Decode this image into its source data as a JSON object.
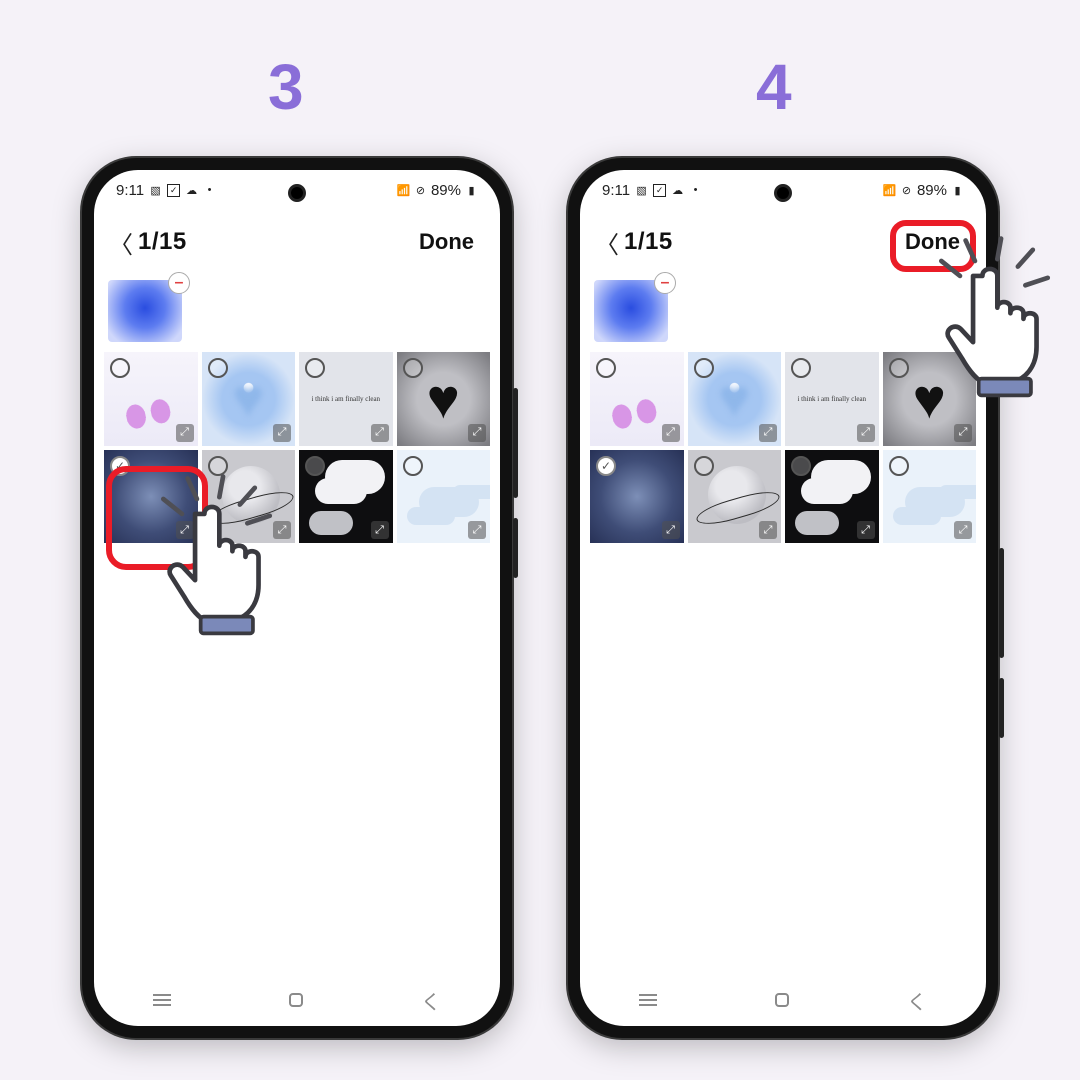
{
  "steps": {
    "left_number": "3",
    "right_number": "4"
  },
  "status": {
    "time": "9:11",
    "battery_text": "89%"
  },
  "header": {
    "counter": "1/15",
    "done_label": "Done"
  },
  "tiles": [
    {
      "kind": "t-butterfly",
      "selected": false
    },
    {
      "kind": "t-blueheart",
      "selected": false
    },
    {
      "kind": "t-text",
      "selected": false
    },
    {
      "kind": "t-darkheart",
      "selected": false
    },
    {
      "kind": "t-navyglow",
      "selected": true
    },
    {
      "kind": "t-planet",
      "selected": false
    },
    {
      "kind": "t-clouds",
      "selected": false
    },
    {
      "kind": "t-skycloud",
      "selected": false
    }
  ],
  "icons": {
    "image": "▧",
    "cloud": "☁",
    "dot": "•",
    "wifi": "📶",
    "nosim": "⊘",
    "batt": "▮",
    "minus": "–",
    "expand": "⤢",
    "back_chevron": "〈",
    "nav_back": "く"
  }
}
